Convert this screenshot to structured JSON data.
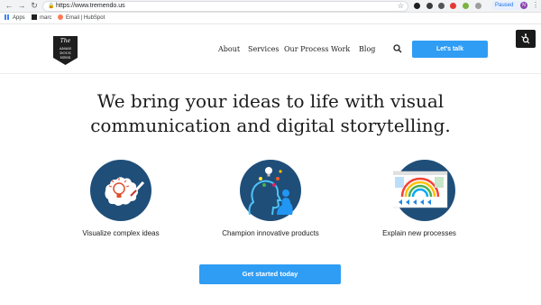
{
  "browser": {
    "url": "https://www.tremendo.us",
    "profile_status": "Paused",
    "profile_initial": "N",
    "bookmarks": [
      {
        "label": "Apps"
      },
      {
        "label": "marc"
      },
      {
        "label": "Email | HubSpot"
      }
    ]
  },
  "site": {
    "logo": {
      "line1": "The",
      "line2": "AMAN",
      "line3": "DOUS",
      "line4": "NESS"
    },
    "nav": [
      {
        "label": "About"
      },
      {
        "label": "Services"
      },
      {
        "label": "Our Process"
      },
      {
        "label": "Work"
      },
      {
        "label": "Blog"
      }
    ],
    "header_cta": "Let's talk",
    "hero_line1": "We bring your ideas to life with visual",
    "hero_line2": "communication and digital storytelling.",
    "features": [
      {
        "label": "Visualize complex ideas",
        "icon": "lightbulb-icon"
      },
      {
        "label": "Champion innovative products",
        "icon": "head-ideas-icon"
      },
      {
        "label": "Explain new processes",
        "icon": "process-diagram-icon"
      }
    ],
    "main_cta": "Get started today"
  },
  "colors": {
    "accent": "#2f9df4",
    "circle_navy": "#1f4e79",
    "text": "#222222"
  }
}
